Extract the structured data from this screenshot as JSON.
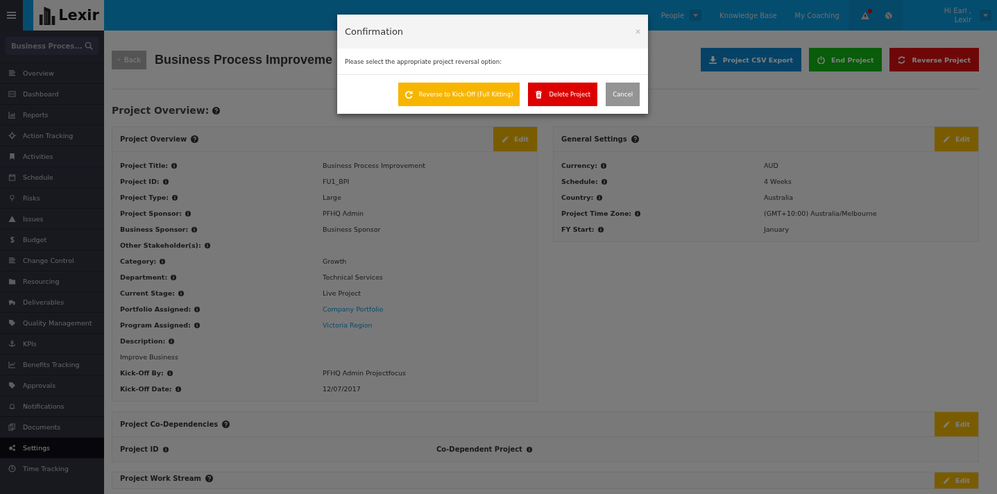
{
  "header": {
    "logo": "Lexir",
    "nav": [
      {
        "label": "People",
        "selected": false,
        "dropdown": true
      },
      {
        "label": "Knowledge Base",
        "selected": false,
        "dropdown": false
      },
      {
        "label": "My Coaching",
        "selected": false,
        "dropdown": false
      }
    ],
    "alert_unread": true,
    "user": {
      "greeting": "Hi Earl ,",
      "name": "Lexir"
    }
  },
  "sidebar": {
    "search": {
      "value": "Business Proces..."
    },
    "items": [
      {
        "label": "Overview",
        "selected": false
      },
      {
        "label": "Dashboard",
        "selected": false
      },
      {
        "label": "Reports",
        "selected": false
      },
      {
        "label": "Action Tracking",
        "selected": false
      },
      {
        "label": "Activities",
        "selected": false
      },
      {
        "label": "Schedule",
        "selected": false
      },
      {
        "label": "Risks",
        "selected": false
      },
      {
        "label": "Issues",
        "selected": false
      },
      {
        "label": "Budget",
        "selected": false
      },
      {
        "label": "Change Control",
        "selected": false
      },
      {
        "label": "Resourcing",
        "selected": false
      },
      {
        "label": "Deliverables",
        "selected": false
      },
      {
        "label": "Quality Management",
        "selected": false
      },
      {
        "label": "KPIs",
        "selected": false
      },
      {
        "label": "Benefits Tracking",
        "selected": false
      },
      {
        "label": "Approvals",
        "selected": false
      },
      {
        "label": "Notifications",
        "selected": false
      },
      {
        "label": "Documents",
        "selected": false
      },
      {
        "label": "Settings",
        "selected": true
      },
      {
        "label": "Time Tracking",
        "selected": false
      }
    ]
  },
  "page": {
    "back": "Back",
    "title": "Business Process Improveme",
    "actions": [
      {
        "label": "Project CSV Export",
        "kind": "export"
      },
      {
        "label": "End Project",
        "kind": "end"
      },
      {
        "label": "Reverse Project",
        "kind": "reverse"
      }
    ],
    "section_title": "Project Overview:",
    "project_overview": {
      "title": "Project Overview",
      "edit": "Edit",
      "fields": [
        {
          "label": "Project Title:",
          "value": "Business Process Improvement",
          "kind": "text"
        },
        {
          "label": "Project ID:",
          "value": "FU1_BPI",
          "kind": "text"
        },
        {
          "label": "Project Type:",
          "value": "Large",
          "kind": "text"
        },
        {
          "label": "Project Sponsor:",
          "value": "PFHQ Admin",
          "kind": "text"
        },
        {
          "label": "Business Sponsor:",
          "value": "Business Sponsor",
          "kind": "text"
        },
        {
          "label": "Other Stakeholder(s):",
          "kind": "text"
        },
        {
          "label": "Category:",
          "value": "Growth",
          "kind": "text"
        },
        {
          "label": "Department:",
          "value": "Technical Services",
          "kind": "text"
        },
        {
          "label": "Current Stage:",
          "value": "Live Project",
          "kind": "text"
        },
        {
          "label": "Portfolio Assigned:",
          "value": "Company Portfolio",
          "kind": "link"
        },
        {
          "label": "Program Assigned:",
          "value": "Victoria Region",
          "kind": "link"
        },
        {
          "label": "Description:",
          "value": "Improve Business",
          "kind": "stacked"
        },
        {
          "label": "Kick-Off By:",
          "value": "PFHQ Admin Projectfocus",
          "kind": "text"
        },
        {
          "label": "Kick-Off Date:",
          "value": "12/07/2017",
          "kind": "text"
        }
      ]
    },
    "general_settings": {
      "title": "General Settings",
      "edit": "Edit",
      "fields": [
        {
          "label": "Currency:",
          "value": "AUD"
        },
        {
          "label": "Schedule:",
          "value": "4 Weeks"
        },
        {
          "label": "Country:",
          "value": "Australia"
        },
        {
          "label": "Project Time Zone:",
          "value": "(GMT+10:00) Australia/Melbourne"
        },
        {
          "label": "FY Start:",
          "value": "January"
        }
      ]
    },
    "co_dependencies": {
      "title": "Project Co-Dependencies",
      "edit": "Edit",
      "columns": [
        "Project ID",
        "Co-Dependent Project"
      ]
    },
    "work_stream": {
      "title": "Project Work Stream",
      "edit": "Edit"
    }
  },
  "modal": {
    "title": "Confirmation",
    "message": "Please select the appropriate project reversal option:",
    "buttons": [
      {
        "label": "Reverse to Kick-Off (Full Kitting)",
        "kind": "reverse"
      },
      {
        "label": "Delete Project",
        "kind": "delete"
      },
      {
        "label": "Cancel",
        "kind": "cancel"
      }
    ]
  }
}
